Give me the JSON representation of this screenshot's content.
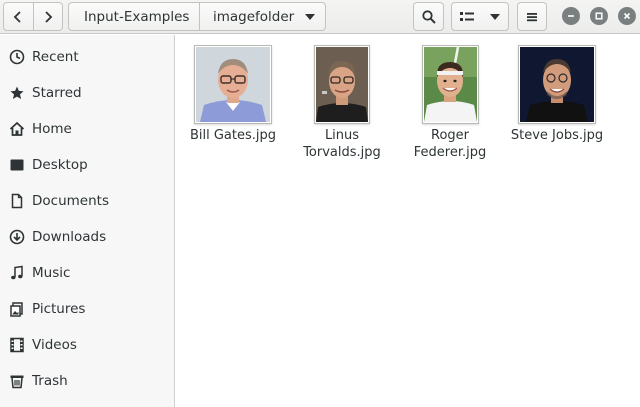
{
  "path": {
    "parent": "Input-Examples",
    "current": "imagefolder"
  },
  "sidebar": {
    "items": [
      {
        "label": "Recent",
        "icon": "clock-icon"
      },
      {
        "label": "Starred",
        "icon": "star-icon"
      },
      {
        "label": "Home",
        "icon": "home-icon"
      },
      {
        "label": "Desktop",
        "icon": "desktop-icon"
      },
      {
        "label": "Documents",
        "icon": "document-icon"
      },
      {
        "label": "Downloads",
        "icon": "download-icon"
      },
      {
        "label": "Music",
        "icon": "music-icon"
      },
      {
        "label": "Pictures",
        "icon": "pictures-icon"
      },
      {
        "label": "Videos",
        "icon": "video-icon"
      },
      {
        "label": "Trash",
        "icon": "trash-icon"
      }
    ]
  },
  "files": [
    {
      "line1": "Bill Gates.jpg",
      "line2": ""
    },
    {
      "line1": "Linus",
      "line2": "Torvalds.jpg"
    },
    {
      "line1": "Roger",
      "line2": "Federer.jpg"
    },
    {
      "line1": "Steve Jobs.jpg",
      "line2": ""
    }
  ],
  "colors": {
    "headerbar": "#ececeb",
    "sidebar_bg": "#f7f7f7",
    "text": "#2e3436",
    "window_button": "#7a7f7f"
  }
}
